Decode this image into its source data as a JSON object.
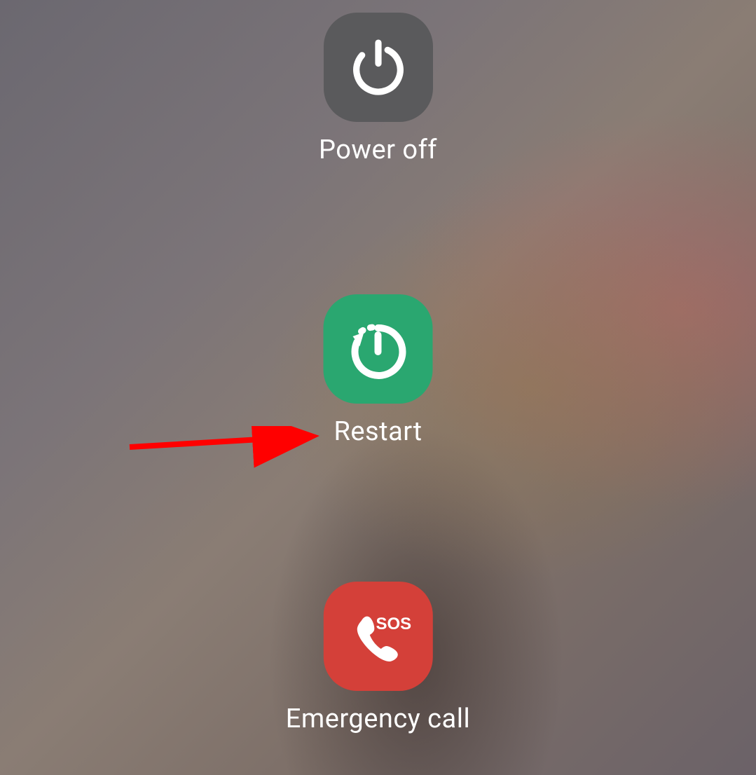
{
  "power_menu": {
    "power_off": {
      "label": "Power off",
      "icon": "power-icon",
      "color": "#5a5a5c"
    },
    "restart": {
      "label": "Restart",
      "icon": "restart-icon",
      "color": "#2aa770"
    },
    "emergency_call": {
      "label": "Emergency call",
      "icon": "phone-sos-icon",
      "sos_text": "SOS",
      "color": "#d44039"
    }
  },
  "annotation": {
    "type": "arrow",
    "color": "#ff0000",
    "points_to": "restart"
  }
}
